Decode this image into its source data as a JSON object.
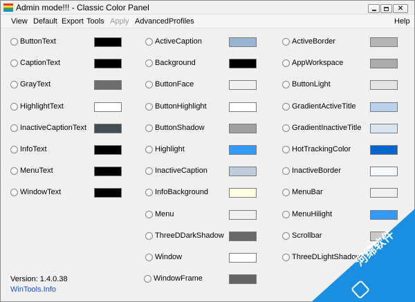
{
  "window": {
    "title": "Admin mode!!! - Classic Color Panel",
    "icon_colors": [
      "#e53935",
      "#fdd835",
      "#43a047",
      "#1e88e5"
    ]
  },
  "menu": [
    {
      "label": "View",
      "enabled": true
    },
    {
      "label": "Default",
      "enabled": true
    },
    {
      "label": "Export",
      "enabled": true
    },
    {
      "label": "Tools",
      "enabled": true
    },
    {
      "label": "Apply",
      "enabled": false
    },
    {
      "label": "Advanced",
      "enabled": true
    },
    {
      "label": "Profiles",
      "enabled": true
    },
    {
      "label": "Help",
      "enabled": true
    }
  ],
  "columns": [
    {
      "items": [
        {
          "label": "ButtonText",
          "color": "#000000"
        },
        {
          "label": "CaptionText",
          "color": "#000000"
        },
        {
          "label": "GrayText",
          "color": "#6d6d6d"
        },
        {
          "label": "HighlightText",
          "color": "#ffffff"
        },
        {
          "label": "InactiveCaptionText",
          "color": "#434e54"
        },
        {
          "label": "InfoText",
          "color": "#000000"
        },
        {
          "label": "MenuText",
          "color": "#000000"
        },
        {
          "label": "WindowText",
          "color": "#000000"
        }
      ]
    },
    {
      "items": [
        {
          "label": "ActiveCaption",
          "color": "#99b4d1"
        },
        {
          "label": "Background",
          "color": "#000000"
        },
        {
          "label": "ButtonFace",
          "color": "#f0f0f0"
        },
        {
          "label": "ButtonHighlight",
          "color": "#ffffff"
        },
        {
          "label": "ButtonShadow",
          "color": "#a0a0a0"
        },
        {
          "label": "Highlight",
          "color": "#3399ff"
        },
        {
          "label": "InactiveCaption",
          "color": "#bfcddb"
        },
        {
          "label": "InfoBackground",
          "color": "#ffffe1"
        },
        {
          "label": "Menu",
          "color": "#f0f0f0"
        },
        {
          "label": "ThreeDDarkShadow",
          "color": "#696969"
        },
        {
          "label": "Window",
          "color": "#ffffff"
        },
        {
          "label": "WindowFrame",
          "color": "#646464"
        }
      ]
    },
    {
      "items": [
        {
          "label": "ActiveBorder",
          "color": "#b4b4b4"
        },
        {
          "label": "AppWorkspace",
          "color": "#ababab"
        },
        {
          "label": "ButtonLight",
          "color": "#e3e3e3"
        },
        {
          "label": "GradientActiveTitle",
          "color": "#b9d1ea"
        },
        {
          "label": "GradientInactiveTitle",
          "color": "#d7e4f2"
        },
        {
          "label": "HotTrackingColor",
          "color": "#0066cc"
        },
        {
          "label": "InactiveBorder",
          "color": "#f4f7fc"
        },
        {
          "label": "MenuBar",
          "color": "#f0f0f0"
        },
        {
          "label": "MenuHilight",
          "color": "#3399ff"
        },
        {
          "label": "Scrollbar",
          "color": "#c8c8c8"
        },
        {
          "label": "ThreeDLightShadow",
          "color": "#e3e3e3"
        }
      ]
    }
  ],
  "footer": {
    "version": "Version: 1.4.0.38",
    "link": "WinTools.Info"
  },
  "watermark": {
    "text": "河绵软件",
    "color": "#1a8ee0"
  }
}
